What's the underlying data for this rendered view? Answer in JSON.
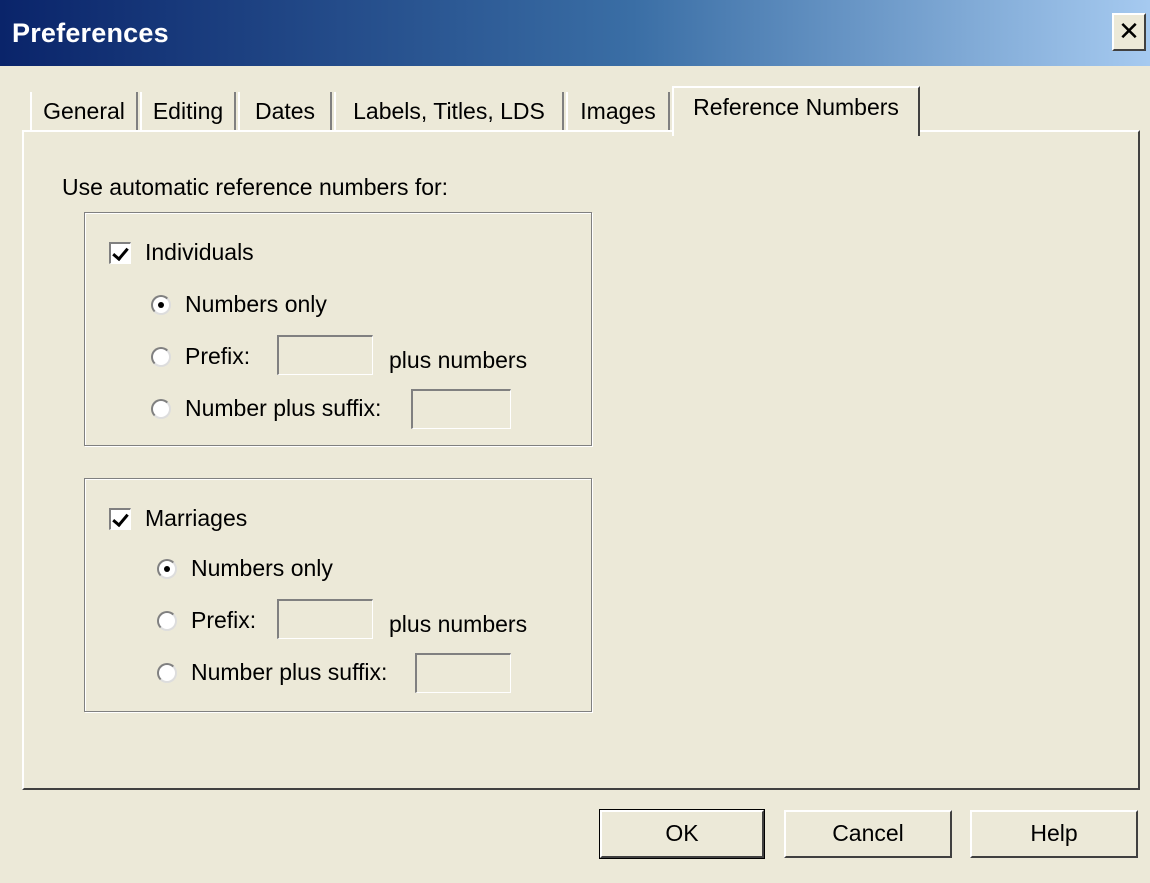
{
  "window": {
    "title": "Preferences",
    "close_glyph": "✕"
  },
  "tabs": [
    {
      "label": "General",
      "active": false
    },
    {
      "label": "Editing",
      "active": false
    },
    {
      "label": "Dates",
      "active": false
    },
    {
      "label": "Labels, Titles, LDS",
      "active": false
    },
    {
      "label": "Images",
      "active": false
    },
    {
      "label": "Reference Numbers",
      "active": true
    }
  ],
  "panel": {
    "intro": "Use automatic reference numbers for:",
    "individuals": {
      "label": "Individuals",
      "checked": true,
      "numbers_only": "Numbers only",
      "prefix": "Prefix:",
      "plus_numbers": "plus numbers",
      "suffix": "Number plus suffix:",
      "selected": "numbers_only",
      "prefix_value": "",
      "suffix_value": ""
    },
    "marriages": {
      "label": "Marriages",
      "checked": true,
      "numbers_only": "Numbers only",
      "prefix": "Prefix:",
      "plus_numbers": "plus numbers",
      "suffix": "Number plus suffix:",
      "selected": "numbers_only",
      "prefix_value": "",
      "suffix_value": ""
    }
  },
  "buttons": {
    "ok": "OK",
    "cancel": "Cancel",
    "help": "Help"
  }
}
